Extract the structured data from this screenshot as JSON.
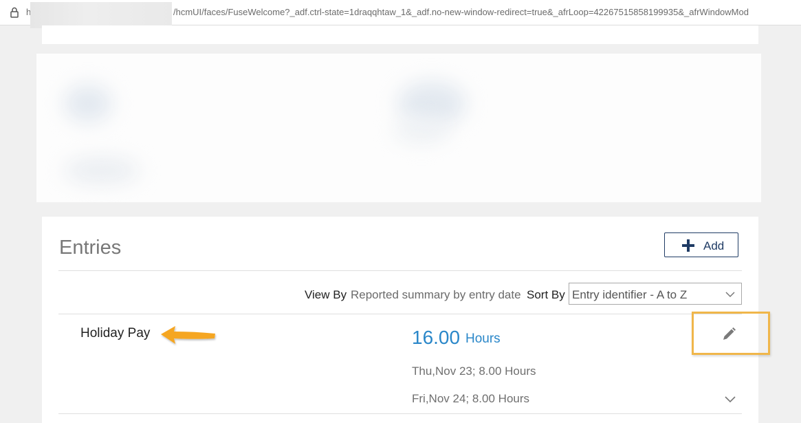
{
  "browser": {
    "url_prefix": "h",
    "url": "/hcmUI/faces/FuseWelcome?_adf.ctrl-state=1draqqhtaw_1&_adf.no-new-window-redirect=true&_afrLoop=42267515858199935&_afrWindowMod"
  },
  "entries": {
    "title": "Entries",
    "add_label": "Add",
    "view_by_label": "View By",
    "view_by_value": "Reported summary by entry date",
    "sort_by_label": "Sort By",
    "sort_by_value": "Entry identifier - A to Z",
    "items": [
      {
        "name": "Holiday Pay",
        "total": "16.00",
        "unit": "Hours",
        "details": [
          "Thu,Nov 23; 8.00 Hours",
          "Fri,Nov 24; 8.00 Hours"
        ]
      }
    ]
  },
  "colors": {
    "accent_blue": "#2a87c9",
    "button_navy": "#1f3b64",
    "highlight_orange": "#f0b64a",
    "arrow_orange": "#f5a623"
  },
  "icons": [
    "lock-icon",
    "plus-icon",
    "chevron-down-icon",
    "pencil-icon",
    "arrow-icon"
  ]
}
